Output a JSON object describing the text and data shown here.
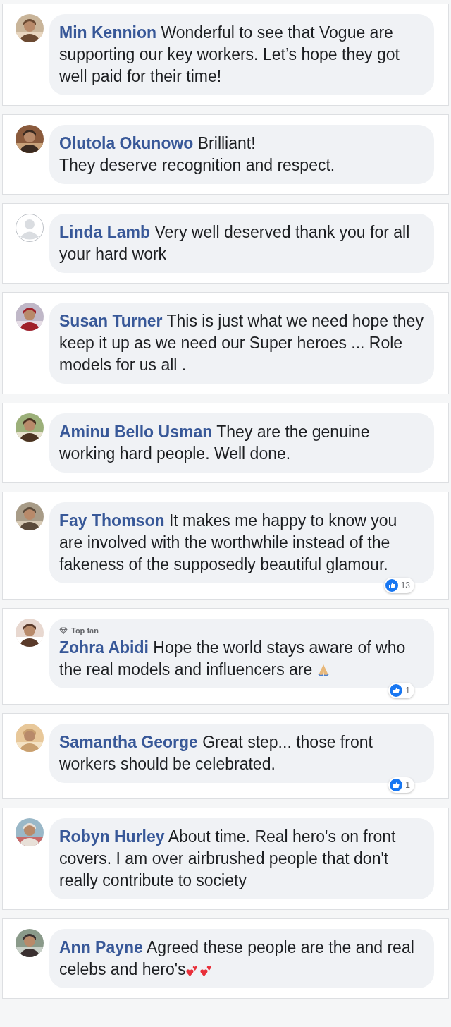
{
  "comments": [
    {
      "author": "Min Kennion",
      "text": "Wonderful to see that Vogue are supporting our key workers. Let’s hope they got well paid for their time!"
    },
    {
      "author": "Olutola Okunowo",
      "text": "Brilliant!\nThey deserve recognition and respect."
    },
    {
      "author": "Linda Lamb",
      "avatar": {
        "kind": "default"
      },
      "text": "Very well deserved thank you for all your hard work"
    },
    {
      "author": "Susan Turner",
      "text": "This is just what we need hope they keep it up as we need our Super heroes ... Role models for us all ."
    },
    {
      "author": "Aminu Bello Usman",
      "text": "They are the genuine working hard people. Well done."
    },
    {
      "author": "Fay Thomson",
      "text": "It makes me happy to know you are involved with the worthwhile instead of the fakeness of the supposedly beautiful glamour.",
      "likes": "13"
    },
    {
      "author": "Zohra Abidi",
      "badge": "Top fan",
      "text": "Hope the world stays aware of who the real models and influencers are",
      "emoji": {
        "kind": "pray"
      },
      "likes": "1"
    },
    {
      "author": "Samantha George",
      "text": "Great step... those front workers should be celebrated.",
      "likes": "1"
    },
    {
      "author": "Robyn Hurley",
      "text": "About time. Real hero's on front covers. I am over airbrushed people that don't really contribute to society"
    },
    {
      "author": "Ann Payne",
      "text": "Agreed these people are the and real celebs and hero's",
      "emoji": {
        "kind": "hearts"
      }
    }
  ]
}
